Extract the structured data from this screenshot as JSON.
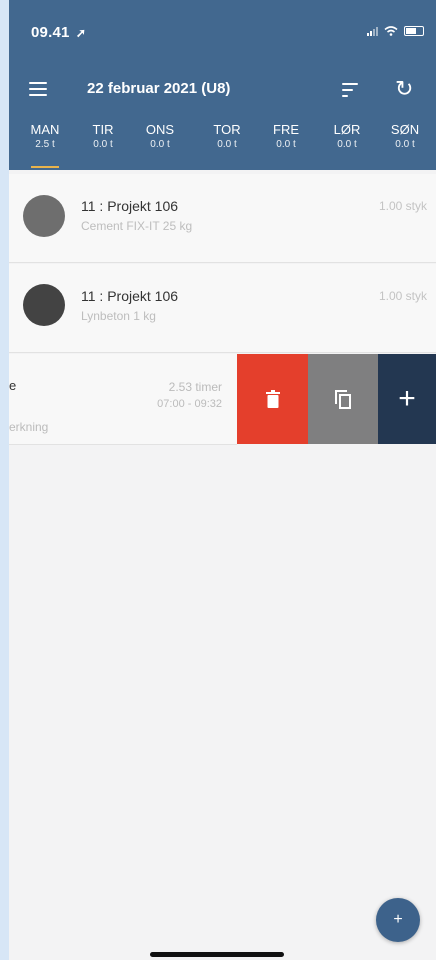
{
  "status": {
    "time": "09.41",
    "location_arrow": "➚"
  },
  "header": {
    "title": "22 februar 2021 (U8)",
    "refresh_glyph": "↻"
  },
  "days": [
    {
      "name": "MAN",
      "hours": "2.5 t"
    },
    {
      "name": "TIR",
      "hours": "0.0 t"
    },
    {
      "name": "ONS",
      "hours": "0.0 t"
    },
    {
      "name": "TOR",
      "hours": "0.0 t"
    },
    {
      "name": "FRE",
      "hours": "0.0 t"
    },
    {
      "name": "LØR",
      "hours": "0.0 t"
    },
    {
      "name": "SØN",
      "hours": "0.0 t"
    }
  ],
  "entries": [
    {
      "title": "11 : Projekt 106",
      "subtitle": "Cement FIX-IT 25 kg",
      "qty": "1.00 styk",
      "avatar_color": "#6e6e6e"
    },
    {
      "title": "11 : Projekt 106",
      "subtitle": "Lynbeton 1 kg",
      "qty": "1.00 styk",
      "avatar_color": "#434343"
    }
  ],
  "swiped_entry": {
    "title_fragment": "e",
    "hours": "2.53 timer",
    "time_range": "07:00 - 09:32",
    "note_fragment": "erkning"
  },
  "actions": {
    "add_glyph": "+"
  },
  "fab": {
    "label": "+"
  },
  "colors": {
    "header": "#42688f",
    "delete": "#e43f2c",
    "copy": "#7f7f80",
    "add": "#233751",
    "active_underline": "#e9b44c"
  }
}
